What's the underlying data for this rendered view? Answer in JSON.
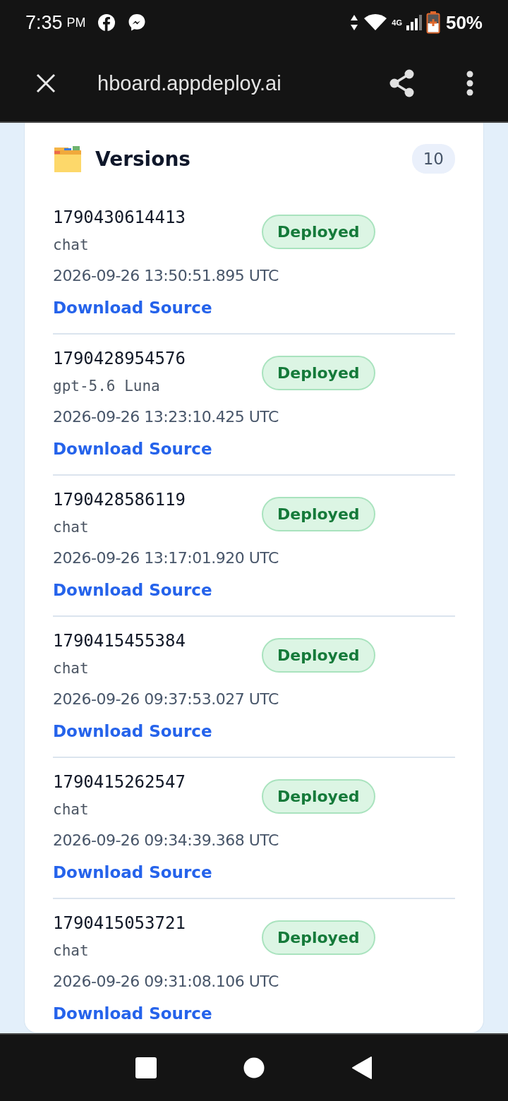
{
  "status_bar": {
    "time": "7:35",
    "ampm": "PM",
    "network": "4G",
    "battery": "50%"
  },
  "app_bar": {
    "url": "hboard.appdeploy.ai"
  },
  "card": {
    "title": "Versions",
    "count": "10"
  },
  "versions": [
    {
      "id": "1790430614413",
      "model": "chat",
      "date": "2026-09-26 13:50:51.895 UTC",
      "status": "Deployed",
      "link": "Download Source"
    },
    {
      "id": "1790428954576",
      "model": "gpt-5.6 Luna",
      "date": "2026-09-26 13:23:10.425 UTC",
      "status": "Deployed",
      "link": "Download Source"
    },
    {
      "id": "1790428586119",
      "model": "chat",
      "date": "2026-09-26 13:17:01.920 UTC",
      "status": "Deployed",
      "link": "Download Source"
    },
    {
      "id": "1790415455384",
      "model": "chat",
      "date": "2026-09-26 09:37:53.027 UTC",
      "status": "Deployed",
      "link": "Download Source"
    },
    {
      "id": "1790415262547",
      "model": "chat",
      "date": "2026-09-26 09:34:39.368 UTC",
      "status": "Deployed",
      "link": "Download Source"
    },
    {
      "id": "1790415053721",
      "model": "chat",
      "date": "2026-09-26 09:31:08.106 UTC",
      "status": "Deployed",
      "link": "Download Source"
    }
  ]
}
